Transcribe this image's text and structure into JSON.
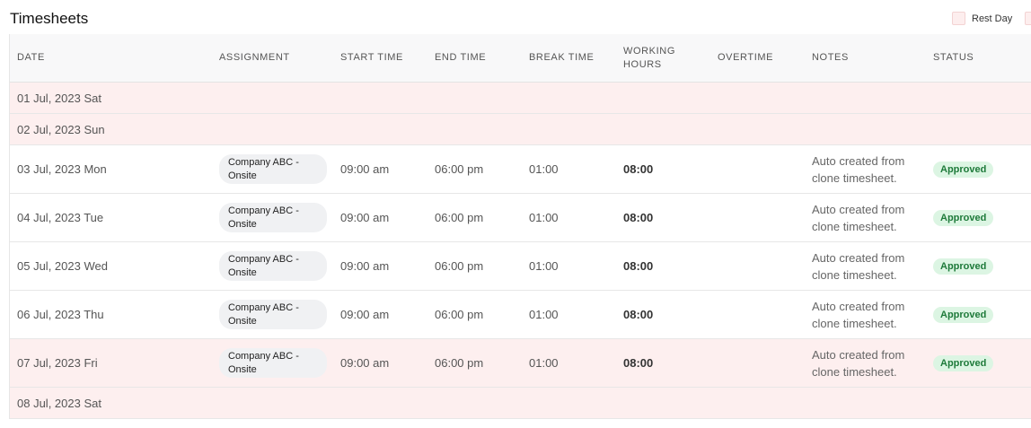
{
  "page": {
    "title": "Timesheets"
  },
  "legend": {
    "rest_day_label": "Rest Day"
  },
  "columns": [
    "DATE",
    "ASSIGNMENT",
    "START TIME",
    "END TIME",
    "BREAK TIME",
    "WORKING HOURS",
    "OVERTIME",
    "NOTES",
    "STATUS"
  ],
  "rows": [
    {
      "date": "01 Jul, 2023 Sat",
      "rest": true
    },
    {
      "date": "02 Jul, 2023 Sun",
      "rest": true
    },
    {
      "date": "03 Jul, 2023 Mon",
      "rest": false,
      "assignment": "Company ABC - Onsite",
      "start": "09:00 am",
      "end": "06:00 pm",
      "break": "01:00",
      "hours": "08:00",
      "overtime": "",
      "notes": "Auto created from clone timesheet.",
      "status": "Approved"
    },
    {
      "date": "04 Jul, 2023 Tue",
      "rest": false,
      "assignment": "Company ABC - Onsite",
      "start": "09:00 am",
      "end": "06:00 pm",
      "break": "01:00",
      "hours": "08:00",
      "overtime": "",
      "notes": "Auto created from clone timesheet.",
      "status": "Approved"
    },
    {
      "date": "05 Jul, 2023 Wed",
      "rest": false,
      "assignment": "Company ABC - Onsite",
      "start": "09:00 am",
      "end": "06:00 pm",
      "break": "01:00",
      "hours": "08:00",
      "overtime": "",
      "notes": "Auto created from clone timesheet.",
      "status": "Approved"
    },
    {
      "date": "06 Jul, 2023 Thu",
      "rest": false,
      "assignment": "Company ABC - Onsite",
      "start": "09:00 am",
      "end": "06:00 pm",
      "break": "01:00",
      "hours": "08:00",
      "overtime": "",
      "notes": "Auto created from clone timesheet.",
      "status": "Approved"
    },
    {
      "date": "07 Jul, 2023 Fri",
      "rest": true,
      "assignment": "Company ABC - Onsite",
      "start": "09:00 am",
      "end": "06:00 pm",
      "break": "01:00",
      "hours": "08:00",
      "overtime": "",
      "notes": "Auto created from clone timesheet.",
      "status": "Approved"
    },
    {
      "date": "08 Jul, 2023 Sat",
      "rest": true
    }
  ]
}
